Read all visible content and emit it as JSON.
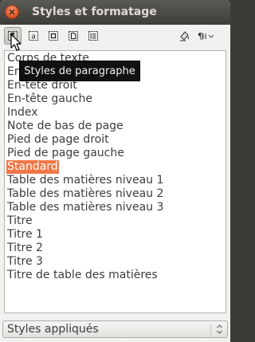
{
  "window": {
    "title": "Styles et formatage"
  },
  "toolbar": {
    "buttons": [
      {
        "icon": "paragraph-styles-icon",
        "active": true
      },
      {
        "icon": "character-styles-icon",
        "active": false
      },
      {
        "icon": "frame-styles-icon",
        "active": false
      },
      {
        "icon": "page-styles-icon",
        "active": false
      },
      {
        "icon": "list-styles-icon",
        "active": false
      },
      {
        "icon": "fill-format-mode-icon",
        "active": false
      },
      {
        "icon": "new-style-menu-icon",
        "active": false
      }
    ]
  },
  "tooltip": {
    "text": "Styles de paragraphe"
  },
  "styles_list": {
    "items": [
      "Corps de texte",
      "En-tête",
      "En-tête droit",
      "En-tête gauche",
      "Index",
      "Note de bas de page",
      "Pied de page droit",
      "Pied de page gauche",
      "Standard",
      "Table des matières niveau 1",
      "Table des matières niveau 2",
      "Table des matières niveau 3",
      "Titre",
      "Titre 1",
      "Titre 2",
      "Titre 3",
      "Titre de table des matières"
    ],
    "selected": "Standard"
  },
  "filter": {
    "selected": "Styles appliqués"
  },
  "colors": {
    "accent": "#f07746",
    "titlebar": "#3e3d39",
    "close": "#e0592a"
  }
}
